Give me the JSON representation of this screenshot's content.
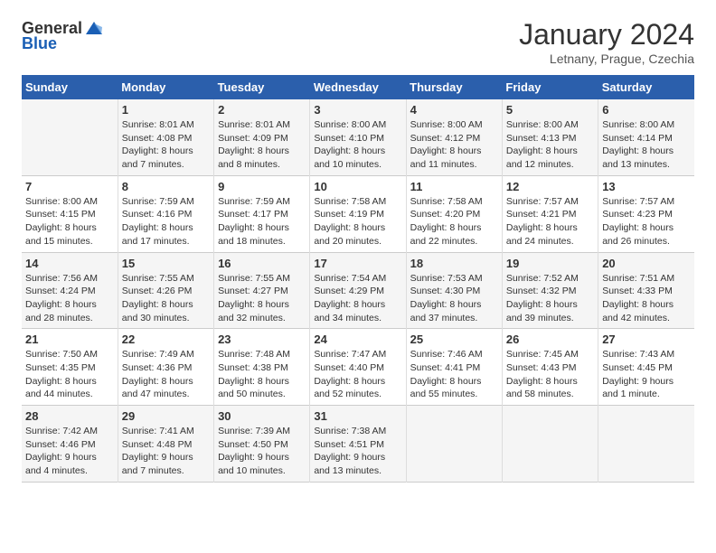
{
  "header": {
    "logo_general": "General",
    "logo_blue": "Blue",
    "month_title": "January 2024",
    "subtitle": "Letnany, Prague, Czechia"
  },
  "days_of_week": [
    "Sunday",
    "Monday",
    "Tuesday",
    "Wednesday",
    "Thursday",
    "Friday",
    "Saturday"
  ],
  "weeks": [
    [
      {
        "day": "",
        "content": ""
      },
      {
        "day": "1",
        "content": "Sunrise: 8:01 AM\nSunset: 4:08 PM\nDaylight: 8 hours\nand 7 minutes."
      },
      {
        "day": "2",
        "content": "Sunrise: 8:01 AM\nSunset: 4:09 PM\nDaylight: 8 hours\nand 8 minutes."
      },
      {
        "day": "3",
        "content": "Sunrise: 8:00 AM\nSunset: 4:10 PM\nDaylight: 8 hours\nand 10 minutes."
      },
      {
        "day": "4",
        "content": "Sunrise: 8:00 AM\nSunset: 4:12 PM\nDaylight: 8 hours\nand 11 minutes."
      },
      {
        "day": "5",
        "content": "Sunrise: 8:00 AM\nSunset: 4:13 PM\nDaylight: 8 hours\nand 12 minutes."
      },
      {
        "day": "6",
        "content": "Sunrise: 8:00 AM\nSunset: 4:14 PM\nDaylight: 8 hours\nand 13 minutes."
      }
    ],
    [
      {
        "day": "7",
        "content": "Sunrise: 8:00 AM\nSunset: 4:15 PM\nDaylight: 8 hours\nand 15 minutes."
      },
      {
        "day": "8",
        "content": "Sunrise: 7:59 AM\nSunset: 4:16 PM\nDaylight: 8 hours\nand 17 minutes."
      },
      {
        "day": "9",
        "content": "Sunrise: 7:59 AM\nSunset: 4:17 PM\nDaylight: 8 hours\nand 18 minutes."
      },
      {
        "day": "10",
        "content": "Sunrise: 7:58 AM\nSunset: 4:19 PM\nDaylight: 8 hours\nand 20 minutes."
      },
      {
        "day": "11",
        "content": "Sunrise: 7:58 AM\nSunset: 4:20 PM\nDaylight: 8 hours\nand 22 minutes."
      },
      {
        "day": "12",
        "content": "Sunrise: 7:57 AM\nSunset: 4:21 PM\nDaylight: 8 hours\nand 24 minutes."
      },
      {
        "day": "13",
        "content": "Sunrise: 7:57 AM\nSunset: 4:23 PM\nDaylight: 8 hours\nand 26 minutes."
      }
    ],
    [
      {
        "day": "14",
        "content": "Sunrise: 7:56 AM\nSunset: 4:24 PM\nDaylight: 8 hours\nand 28 minutes."
      },
      {
        "day": "15",
        "content": "Sunrise: 7:55 AM\nSunset: 4:26 PM\nDaylight: 8 hours\nand 30 minutes."
      },
      {
        "day": "16",
        "content": "Sunrise: 7:55 AM\nSunset: 4:27 PM\nDaylight: 8 hours\nand 32 minutes."
      },
      {
        "day": "17",
        "content": "Sunrise: 7:54 AM\nSunset: 4:29 PM\nDaylight: 8 hours\nand 34 minutes."
      },
      {
        "day": "18",
        "content": "Sunrise: 7:53 AM\nSunset: 4:30 PM\nDaylight: 8 hours\nand 37 minutes."
      },
      {
        "day": "19",
        "content": "Sunrise: 7:52 AM\nSunset: 4:32 PM\nDaylight: 8 hours\nand 39 minutes."
      },
      {
        "day": "20",
        "content": "Sunrise: 7:51 AM\nSunset: 4:33 PM\nDaylight: 8 hours\nand 42 minutes."
      }
    ],
    [
      {
        "day": "21",
        "content": "Sunrise: 7:50 AM\nSunset: 4:35 PM\nDaylight: 8 hours\nand 44 minutes."
      },
      {
        "day": "22",
        "content": "Sunrise: 7:49 AM\nSunset: 4:36 PM\nDaylight: 8 hours\nand 47 minutes."
      },
      {
        "day": "23",
        "content": "Sunrise: 7:48 AM\nSunset: 4:38 PM\nDaylight: 8 hours\nand 50 minutes."
      },
      {
        "day": "24",
        "content": "Sunrise: 7:47 AM\nSunset: 4:40 PM\nDaylight: 8 hours\nand 52 minutes."
      },
      {
        "day": "25",
        "content": "Sunrise: 7:46 AM\nSunset: 4:41 PM\nDaylight: 8 hours\nand 55 minutes."
      },
      {
        "day": "26",
        "content": "Sunrise: 7:45 AM\nSunset: 4:43 PM\nDaylight: 8 hours\nand 58 minutes."
      },
      {
        "day": "27",
        "content": "Sunrise: 7:43 AM\nSunset: 4:45 PM\nDaylight: 9 hours\nand 1 minute."
      }
    ],
    [
      {
        "day": "28",
        "content": "Sunrise: 7:42 AM\nSunset: 4:46 PM\nDaylight: 9 hours\nand 4 minutes."
      },
      {
        "day": "29",
        "content": "Sunrise: 7:41 AM\nSunset: 4:48 PM\nDaylight: 9 hours\nand 7 minutes."
      },
      {
        "day": "30",
        "content": "Sunrise: 7:39 AM\nSunset: 4:50 PM\nDaylight: 9 hours\nand 10 minutes."
      },
      {
        "day": "31",
        "content": "Sunrise: 7:38 AM\nSunset: 4:51 PM\nDaylight: 9 hours\nand 13 minutes."
      },
      {
        "day": "",
        "content": ""
      },
      {
        "day": "",
        "content": ""
      },
      {
        "day": "",
        "content": ""
      }
    ]
  ]
}
